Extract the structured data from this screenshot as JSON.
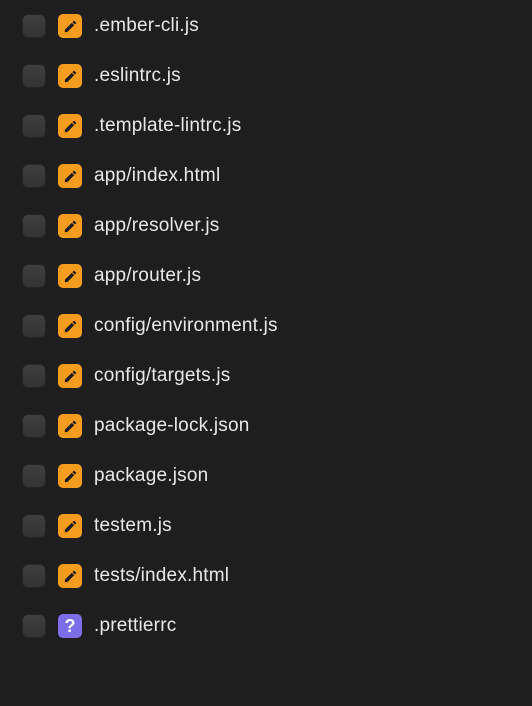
{
  "files": [
    {
      "name": ".ember-cli.js",
      "status": "modified"
    },
    {
      "name": ".eslintrc.js",
      "status": "modified"
    },
    {
      "name": ".template-lintrc.js",
      "status": "modified"
    },
    {
      "name": "app/index.html",
      "status": "modified"
    },
    {
      "name": "app/resolver.js",
      "status": "modified"
    },
    {
      "name": "app/router.js",
      "status": "modified"
    },
    {
      "name": "config/environment.js",
      "status": "modified"
    },
    {
      "name": "config/targets.js",
      "status": "modified"
    },
    {
      "name": "package-lock.json",
      "status": "modified"
    },
    {
      "name": "package.json",
      "status": "modified"
    },
    {
      "name": "testem.js",
      "status": "modified"
    },
    {
      "name": "tests/index.html",
      "status": "modified"
    },
    {
      "name": ".prettierrc",
      "status": "unknown"
    }
  ],
  "icons": {
    "modified_glyph": "pencil",
    "unknown_glyph": "?"
  },
  "colors": {
    "modified": "#f59b1d",
    "unknown": "#7c6ee8",
    "background": "#1e1e1e",
    "text": "#e8e8e8"
  }
}
